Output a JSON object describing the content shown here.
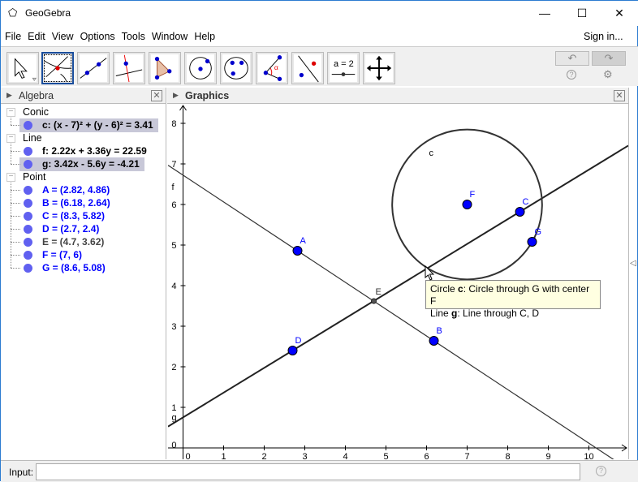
{
  "window": {
    "title": "GeoGebra",
    "minimize": "—",
    "maximize": "☐",
    "close": "✕"
  },
  "menu": [
    "File",
    "Edit",
    "View",
    "Options",
    "Tools",
    "Window",
    "Help"
  ],
  "sign_in": "Sign in...",
  "toolbar": {
    "tools": [
      "move",
      "intersect",
      "line",
      "perpendicular-line",
      "polygon",
      "circle-center-point",
      "circle-three-points",
      "angle",
      "reflect",
      "slider",
      "move-graphics-view"
    ],
    "selected": 1,
    "slider_label": "a = 2",
    "undo": "↶",
    "redo": "↷",
    "help": "?",
    "settings": "⚙"
  },
  "algebra": {
    "title": "Algebra",
    "groups": [
      {
        "name": "Conic",
        "items": [
          {
            "text": "c: (x - 7)² + (y - 6)² = 3.41",
            "color": "#000000",
            "hl": true
          }
        ]
      },
      {
        "name": "Line",
        "items": [
          {
            "text": "f: 2.22x + 3.36y = 22.59",
            "color": "#000000",
            "hl": false
          },
          {
            "text": "g: 3.42x - 5.6y = -4.21",
            "color": "#000000",
            "hl": true
          }
        ]
      },
      {
        "name": "Point",
        "items": [
          {
            "text": "A = (2.82, 4.86)",
            "color": "#0000ff"
          },
          {
            "text": "B = (6.18, 2.64)",
            "color": "#0000ff"
          },
          {
            "text": "C = (8.3, 5.82)",
            "color": "#0000ff"
          },
          {
            "text": "D = (2.7, 2.4)",
            "color": "#0000ff"
          },
          {
            "text": "E = (4.7, 3.62)",
            "color": "#444444"
          },
          {
            "text": "F = (7, 6)",
            "color": "#0000ff"
          },
          {
            "text": "G = (8.6, 5.08)",
            "color": "#0000ff"
          }
        ]
      }
    ]
  },
  "graphics": {
    "title": "Graphics",
    "x_ticks": [
      0,
      1,
      2,
      3,
      4,
      5,
      6,
      7,
      8,
      9,
      10
    ],
    "y_ticks": [
      0,
      1,
      2,
      3,
      4,
      5,
      6,
      7,
      8
    ],
    "points": [
      {
        "name": "A",
        "x": 2.82,
        "y": 4.86
      },
      {
        "name": "B",
        "x": 6.18,
        "y": 2.64
      },
      {
        "name": "C",
        "x": 8.3,
        "y": 5.82
      },
      {
        "name": "D",
        "x": 2.7,
        "y": 2.4
      },
      {
        "name": "F",
        "x": 7,
        "y": 6
      },
      {
        "name": "G",
        "x": 8.6,
        "y": 5.08
      }
    ],
    "aux_points": [
      {
        "name": "E",
        "x": 4.7,
        "y": 3.62
      }
    ],
    "lines": [
      {
        "name": "f",
        "a": 2.22,
        "b": 3.36,
        "c": 22.59
      },
      {
        "name": "g",
        "a": 3.42,
        "b": -5.6,
        "c": -4.21
      }
    ],
    "circle": {
      "name": "c",
      "cx": 7,
      "cy": 6,
      "r2": 3.41
    },
    "point_color": "#0000ff"
  },
  "tooltip": {
    "line1_prefix": "Circle ",
    "line1_name": "c",
    "line1_rest": ": Circle through G with center F",
    "line2_prefix": "Line ",
    "line2_name": "g",
    "line2_rest": ": Line through C, D"
  },
  "input": {
    "label": "Input:",
    "value": "",
    "help": "?"
  }
}
